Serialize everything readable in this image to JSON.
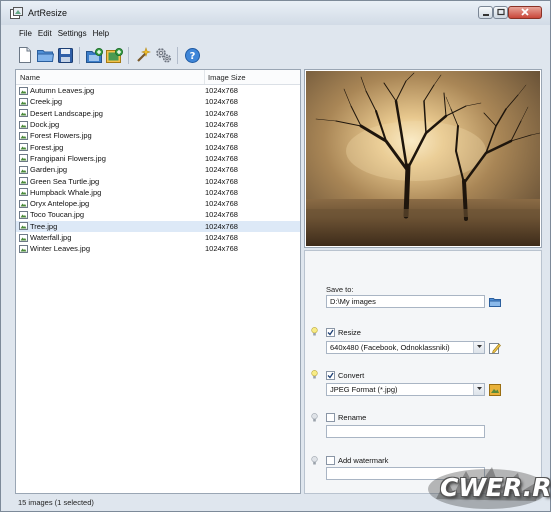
{
  "window": {
    "title": "ArtResize"
  },
  "menu": {
    "items": [
      "File",
      "Edit",
      "Settings",
      "Help"
    ]
  },
  "toolbar": {
    "buttons": [
      "new-file-icon",
      "open-folder-icon",
      "save-icon",
      "add-folder-icon",
      "add-images-icon",
      "magic-wand-icon",
      "gears-icon",
      "help-icon"
    ]
  },
  "filelist": {
    "columns": [
      "Name",
      "Image Size"
    ],
    "rows": [
      {
        "name": "Autumn Leaves.jpg",
        "size": "1024x768"
      },
      {
        "name": "Creek.jpg",
        "size": "1024x768"
      },
      {
        "name": "Desert Landscape.jpg",
        "size": "1024x768"
      },
      {
        "name": "Dock.jpg",
        "size": "1024x768"
      },
      {
        "name": "Forest Flowers.jpg",
        "size": "1024x768"
      },
      {
        "name": "Forest.jpg",
        "size": "1024x768"
      },
      {
        "name": "Frangipani Flowers.jpg",
        "size": "1024x768"
      },
      {
        "name": "Garden.jpg",
        "size": "1024x768"
      },
      {
        "name": "Green Sea Turtle.jpg",
        "size": "1024x768"
      },
      {
        "name": "Humpback Whale.jpg",
        "size": "1024x768"
      },
      {
        "name": "Oryx Antelope.jpg",
        "size": "1024x768"
      },
      {
        "name": "Toco Toucan.jpg",
        "size": "1024x768"
      },
      {
        "name": "Tree.jpg",
        "size": "1024x768"
      },
      {
        "name": "Waterfall.jpg",
        "size": "1024x768"
      },
      {
        "name": "Winter Leaves.jpg",
        "size": "1024x768"
      }
    ],
    "selected_row": "Tree.jpg"
  },
  "options": {
    "save_to_label": "Save to:",
    "save_to_value": "D:\\My images",
    "resize": {
      "label": "Resize",
      "checked": true,
      "value": "640x480 (Facebook, Odnoklassniki)"
    },
    "convert": {
      "label": "Convert",
      "checked": true,
      "value": "JPEG Format (*.jpg)"
    },
    "rename": {
      "label": "Rename",
      "checked": false,
      "value": ""
    },
    "watermark": {
      "label": "Add watermark",
      "checked": false,
      "value": ""
    }
  },
  "status": {
    "text": "15 images (1 selected)"
  },
  "overlay_watermark": {
    "text": "CWER.RU"
  },
  "colors": {
    "selection": "#dde9f7",
    "window_bg": "#dfe6ee",
    "close_button": "#c9473a",
    "accent_blue": "#3a78c8"
  }
}
